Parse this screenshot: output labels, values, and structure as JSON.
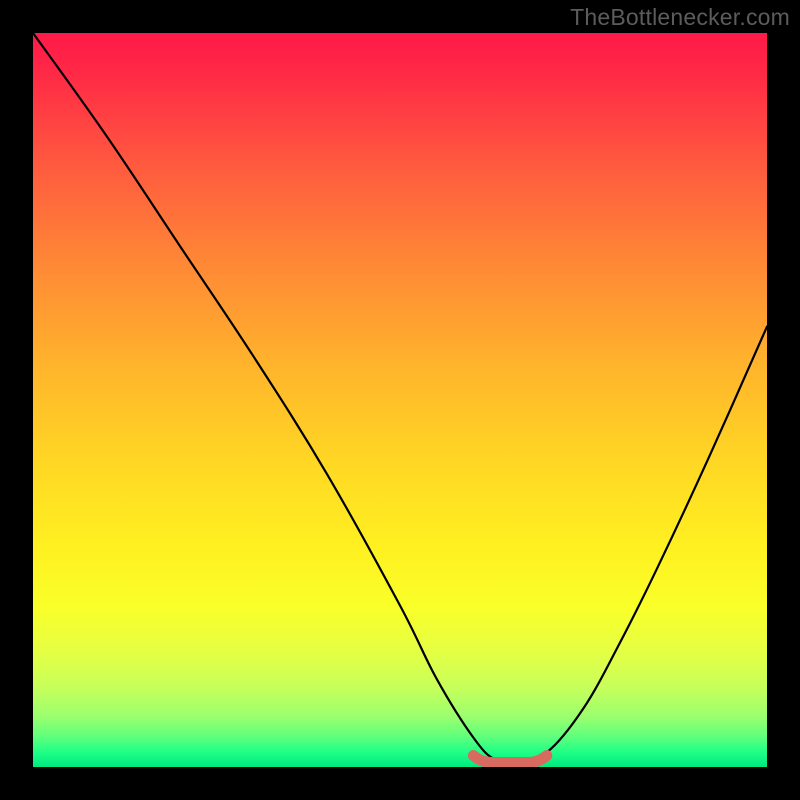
{
  "watermark": {
    "text": "TheBottlenecker.com"
  },
  "chart_data": {
    "type": "line",
    "title": "",
    "xlabel": "",
    "ylabel": "",
    "xlim": [
      0,
      100
    ],
    "ylim": [
      0,
      100
    ],
    "background": "red-yellow-green vertical gradient",
    "series": [
      {
        "name": "bottleneck-curve",
        "color": "#000000",
        "x": [
          0,
          10,
          20,
          30,
          40,
          50,
          55,
          60,
          63,
          66,
          70,
          75,
          80,
          85,
          92,
          100
        ],
        "y": [
          100,
          86,
          71,
          56,
          40,
          22,
          12,
          4,
          1,
          1,
          2,
          8,
          17,
          27,
          42,
          60
        ]
      },
      {
        "name": "optimal-marker",
        "color": "#d96a5f",
        "type": "segment",
        "x": [
          60,
          70
        ],
        "y": [
          1.3,
          1.3
        ]
      }
    ],
    "annotations": []
  }
}
